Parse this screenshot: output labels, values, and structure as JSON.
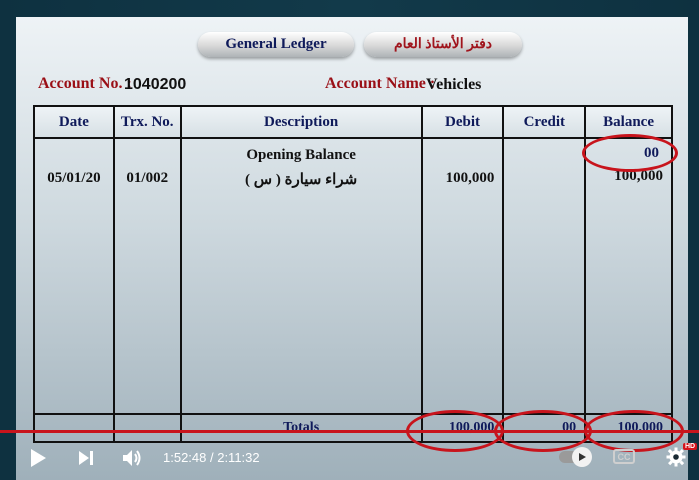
{
  "ledger": {
    "title_en": "General Ledger",
    "title_ar": "دفتر الأستاذ العام",
    "account_no_label": "Account No. :",
    "account_no": "1040200",
    "account_name_label": "Account Name :",
    "account_name": "Vehicles",
    "columns": [
      "Date",
      "Trx. No.",
      "Description",
      "Debit",
      "Credit",
      "Balance"
    ],
    "opening": {
      "description": "Opening Balance",
      "balance": "00"
    },
    "rows": [
      {
        "date": "05/01/20",
        "trx": "01/002",
        "description": "شراء سيارة ( س )",
        "debit": "100,000",
        "credit": "",
        "balance": "100,000"
      }
    ],
    "totals": {
      "label": "Totals",
      "debit": "100,000",
      "credit": "00",
      "balance": "100,000"
    }
  },
  "player": {
    "time": "1:52:48 / 2:11:32",
    "icons": [
      "play-icon",
      "next-icon",
      "volume-icon",
      "autoplay-toggle-icon",
      "captions-icon",
      "settings-icon"
    ],
    "captions_label": "CC",
    "hd_badge": "HD",
    "accent": "#c8141c"
  }
}
